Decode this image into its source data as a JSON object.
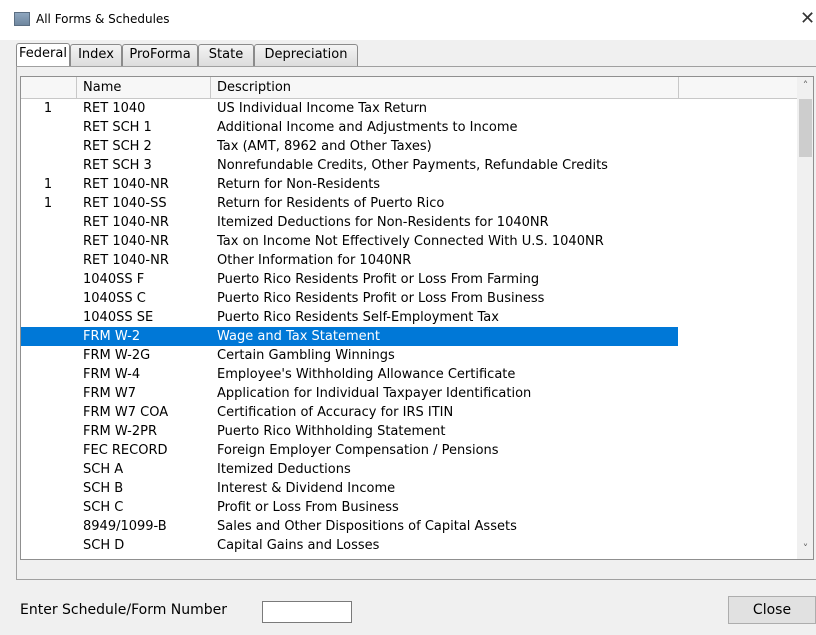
{
  "window": {
    "title": "All Forms & Schedules",
    "close_glyph": "✕"
  },
  "tabs": [
    {
      "label": "Federal",
      "active": true
    },
    {
      "label": "Index",
      "active": false
    },
    {
      "label": "ProForma",
      "active": false
    },
    {
      "label": "State",
      "active": false
    },
    {
      "label": "Depreciation",
      "active": false
    }
  ],
  "table": {
    "columns": [
      "",
      "Name",
      "Description"
    ],
    "selected_index": 12,
    "rows": [
      {
        "num": "1",
        "name": "RET 1040",
        "desc": "US Individual Income Tax Return"
      },
      {
        "num": "",
        "name": "RET SCH 1",
        "desc": "Additional Income and Adjustments to Income"
      },
      {
        "num": "",
        "name": "RET SCH 2",
        "desc": "Tax (AMT, 8962 and Other Taxes)"
      },
      {
        "num": "",
        "name": "RET SCH 3",
        "desc": "Nonrefundable Credits, Other Payments, Refundable Credits"
      },
      {
        "num": "1",
        "name": "RET 1040-NR",
        "desc": "Return for Non-Residents"
      },
      {
        "num": "1",
        "name": "RET 1040-SS",
        "desc": "Return for Residents of Puerto Rico"
      },
      {
        "num": "",
        "name": "RET 1040-NR",
        "desc": "Itemized Deductions for Non-Residents for 1040NR"
      },
      {
        "num": "",
        "name": "RET 1040-NR",
        "desc": "Tax on Income Not Effectively Connected With U.S. 1040NR"
      },
      {
        "num": "",
        "name": "RET 1040-NR",
        "desc": "Other Information for 1040NR"
      },
      {
        "num": "",
        "name": "1040SS F",
        "desc": "Puerto Rico Residents Profit or Loss From Farming"
      },
      {
        "num": "",
        "name": "1040SS C",
        "desc": "Puerto Rico Residents Profit or Loss From Business"
      },
      {
        "num": "",
        "name": "1040SS SE",
        "desc": "Puerto Rico Residents Self-Employment Tax"
      },
      {
        "num": "",
        "name": "FRM W-2",
        "desc": "Wage and Tax Statement"
      },
      {
        "num": "",
        "name": "FRM W-2G",
        "desc": "Certain Gambling Winnings"
      },
      {
        "num": "",
        "name": "FRM W-4",
        "desc": "Employee's Withholding Allowance Certificate"
      },
      {
        "num": "",
        "name": "FRM W7",
        "desc": "Application for Individual Taxpayer Identification"
      },
      {
        "num": "",
        "name": "FRM W7 COA",
        "desc": "Certification of Accuracy for IRS ITIN"
      },
      {
        "num": "",
        "name": "FRM W-2PR",
        "desc": "Puerto Rico Withholding Statement"
      },
      {
        "num": "",
        "name": "FEC RECORD",
        "desc": "Foreign Employer Compensation / Pensions"
      },
      {
        "num": "",
        "name": "SCH A",
        "desc": "Itemized Deductions"
      },
      {
        "num": "",
        "name": "SCH B",
        "desc": "Interest & Dividend Income"
      },
      {
        "num": "",
        "name": "SCH C",
        "desc": "Profit or Loss From Business"
      },
      {
        "num": "",
        "name": "8949/1099-B",
        "desc": "Sales and Other Dispositions of Capital Assets"
      },
      {
        "num": "",
        "name": "SCH D",
        "desc": "Capital Gains and Losses"
      }
    ]
  },
  "scrollbar": {
    "up_glyph": "˄",
    "down_glyph": "˅"
  },
  "footer": {
    "label": "Enter Schedule/Form Number",
    "input_value": "",
    "close_button": "Close"
  },
  "colors": {
    "selection": "#0078d7"
  }
}
